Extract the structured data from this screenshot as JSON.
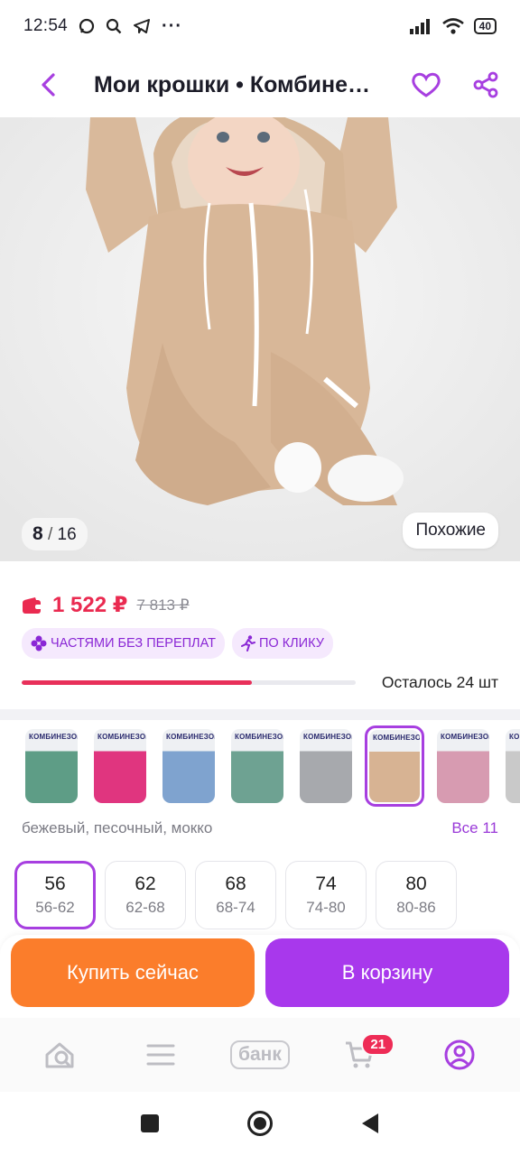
{
  "status_bar": {
    "time": "12:54",
    "battery": "40",
    "icons": [
      "messenger-icon",
      "search-icon",
      "telegram-icon",
      "more-icon",
      "signal-icon",
      "wifi-icon",
      "battery-icon"
    ]
  },
  "header": {
    "title": "Мои крошки • Комбинезон"
  },
  "gallery": {
    "current": "8",
    "separator": " / ",
    "total": "16",
    "similar_label": "Похожие"
  },
  "price": {
    "current": "1 522 ₽",
    "old": "7 813 ₽"
  },
  "badges": [
    {
      "label": "ЧАСТЯМИ БЕЗ ПЕРЕПЛАТ",
      "icon": "installments-icon"
    },
    {
      "label": "ПО КЛИКУ",
      "icon": "running-person-icon"
    }
  ],
  "stock": {
    "text": "Осталось 24 шт",
    "fill_fraction": 0.69,
    "color": "#e8305a"
  },
  "colors": {
    "swatch_label": "КОМБИНЕЗОН",
    "swatch_tints": [
      "#5e9d86",
      "#e0357f",
      "#7fa3cf",
      "#6ea292",
      "#a7a9ad",
      "#d7b393",
      "#d79bb1",
      "#c9c9c9"
    ],
    "selected_index": 5,
    "names": "бежевый, песочный, мокко",
    "all_label": "Все 11"
  },
  "sizes": [
    {
      "main": "56",
      "sub": "56-62",
      "selected": true
    },
    {
      "main": "62",
      "sub": "62-68",
      "selected": false
    },
    {
      "main": "68",
      "sub": "68-74",
      "selected": false
    },
    {
      "main": "74",
      "sub": "74-80",
      "selected": false
    },
    {
      "main": "80",
      "sub": "80-86",
      "selected": false
    }
  ],
  "actions": {
    "buy_now": "Купить сейчас",
    "add_to_cart": "В корзину"
  },
  "bottom_nav": {
    "bank_label": "банк",
    "cart_count": "21"
  },
  "theme": {
    "accent": "#a73fe0",
    "price": "#ea2a50",
    "buy": "#fb7d2b",
    "cart": "#a838ec"
  }
}
